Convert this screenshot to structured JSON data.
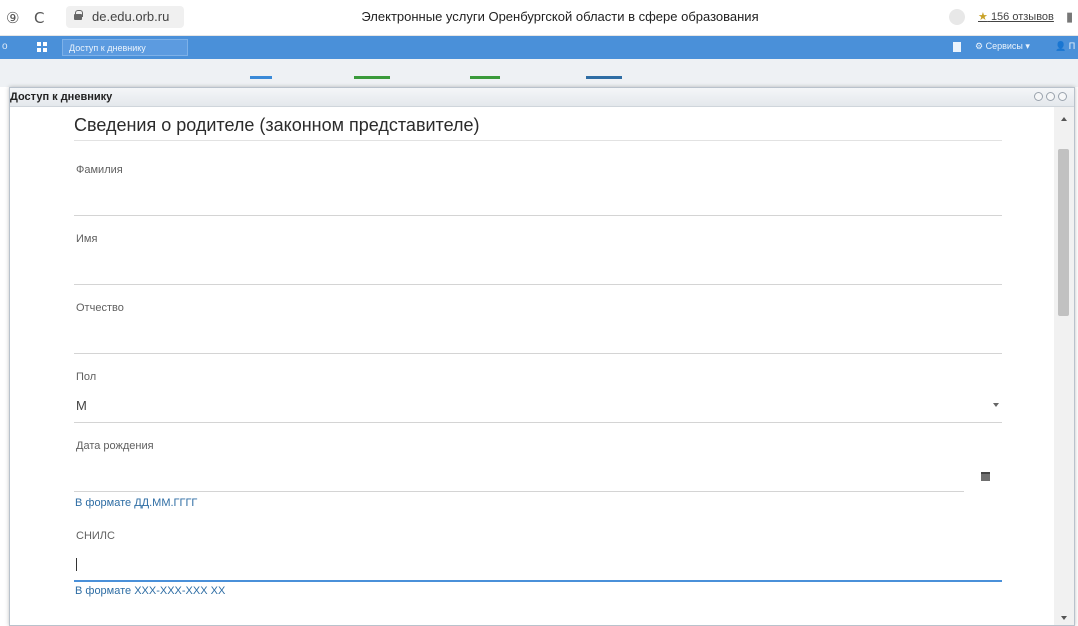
{
  "browser": {
    "back_symbol": "⑨",
    "reload_symbol": "C",
    "url": "de.edu.orb.ru",
    "page_title": "Электронные услуги Оренбургской области в сфере образования",
    "reviews_star": "★",
    "reviews": "156 отзывов"
  },
  "navbar": {
    "left_char": "о",
    "tab_label": "Доступ к дневнику",
    "services_label": "Сервисы",
    "user_label": "П",
    "color": "#4a90d9"
  },
  "modal": {
    "title": "Доступ к дневнику",
    "section_title": "Сведения о родителе (законном представителе)",
    "fields": {
      "surname": {
        "label": "Фамилия",
        "value": ""
      },
      "name": {
        "label": "Имя",
        "value": ""
      },
      "patronymic": {
        "label": "Отчество",
        "value": ""
      },
      "gender": {
        "label": "Пол",
        "value": "М"
      },
      "birth_date": {
        "label": "Дата рождения",
        "value": "",
        "hint": "В формате ДД.ММ.ГГГГ"
      },
      "snils": {
        "label": "СНИЛС",
        "value": "",
        "hint": "В формате XXX-XXX-XXX XX"
      }
    }
  },
  "icons": {
    "secure": "lock-icon",
    "apps": "grid-icon",
    "calendar": "calendar-icon",
    "dropdown": "chevron-down-icon",
    "services": "gear-icon",
    "user": "user-icon"
  },
  "colors": {
    "hint_text": "#2e6da4",
    "active_underline": "#4a90d9"
  }
}
